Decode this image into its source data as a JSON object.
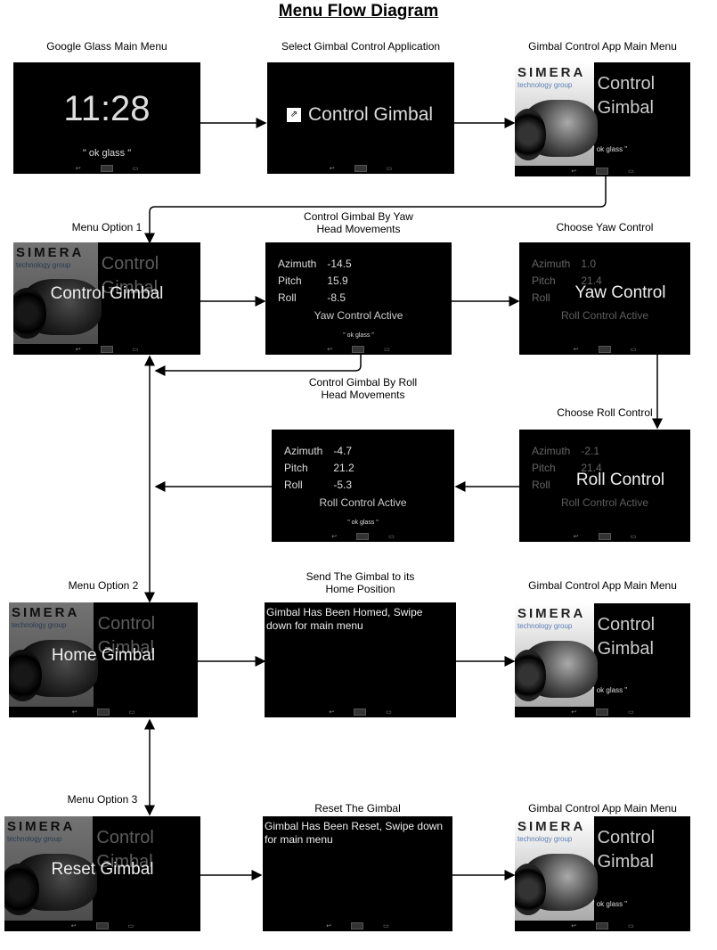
{
  "title": "Menu Flow Diagram",
  "colors": {
    "screen_bg": "#000000",
    "arrow": "#000000",
    "brand_blue": "#5a7fb5"
  },
  "nav_icons": [
    "back-icon",
    "home-icon",
    "recent-apps-icon"
  ],
  "screens": [
    {
      "id": "glass-main",
      "label": "Google Glass Main Menu",
      "type": "clock",
      "time": "11:28",
      "hint": "\" ok glass \""
    },
    {
      "id": "select-app",
      "label": "Select Gimbal Control Application",
      "type": "app",
      "icon": "app-icon",
      "text": "Control Gimbal"
    },
    {
      "id": "app-main-1",
      "label": "Gimbal Control App Main Menu",
      "type": "menu",
      "brand": "SIMERA",
      "brand_sub": "technology group",
      "lines": [
        "Control",
        "Gimbal"
      ],
      "hint": "\" ok glass \""
    },
    {
      "id": "option-1",
      "label": "Menu Option 1",
      "type": "menu",
      "brand": "SIMERA",
      "brand_sub": "technology group",
      "lines": [
        "Control",
        "Gimbal"
      ],
      "overlay": "Control Gimbal"
    },
    {
      "id": "yaw-mode",
      "label": "Control Gimbal By Yaw\nHead Movements",
      "type": "readout",
      "rows": [
        [
          "Azimuth",
          "-14.5"
        ],
        [
          "Pitch",
          "15.9"
        ],
        [
          "Roll",
          "-8.5"
        ]
      ],
      "status": "Yaw Control Active",
      "hint": "\" ok glass \""
    },
    {
      "id": "choose-yaw",
      "label": "Choose Yaw Control",
      "type": "readout",
      "rows": [
        [
          "Azimuth",
          "1.0"
        ],
        [
          "Pitch",
          "21.4"
        ],
        [
          "Roll",
          ""
        ]
      ],
      "status": "Roll Control Active",
      "overlay": "Yaw Control"
    },
    {
      "id": "roll-mode",
      "label": "Control Gimbal By Roll\nHead Movements",
      "type": "readout",
      "rows": [
        [
          "Azimuth",
          "-4.7"
        ],
        [
          "Pitch",
          "21.2"
        ],
        [
          "Roll",
          "-5.3"
        ]
      ],
      "status": "Roll Control Active",
      "hint": "\" ok glass \""
    },
    {
      "id": "choose-roll",
      "label": "Choose Roll Control",
      "type": "readout",
      "rows": [
        [
          "Azimuth",
          "-2.1"
        ],
        [
          "Pitch",
          "21.4"
        ],
        [
          "Roll",
          ""
        ]
      ],
      "status": "Roll Control Active",
      "overlay": "Roll Control"
    },
    {
      "id": "option-2",
      "label": "Menu Option 2",
      "type": "menu",
      "brand": "SIMERA",
      "brand_sub": "technology group",
      "lines": [
        "Control",
        "Gimbal"
      ],
      "overlay": "Home Gimbal"
    },
    {
      "id": "home",
      "label": "Send The Gimbal to its\nHome Position",
      "type": "message",
      "text": "Gimbal Has Been Homed, Swipe down for main menu"
    },
    {
      "id": "app-main-2",
      "label": "Gimbal Control App Main Menu",
      "type": "menu",
      "brand": "SIMERA",
      "brand_sub": "technology group",
      "lines": [
        "Control",
        "Gimbal"
      ],
      "hint": "\" ok glass \""
    },
    {
      "id": "option-3",
      "label": "Menu Option 3",
      "type": "menu",
      "brand": "SIMERA",
      "brand_sub": "technology group",
      "lines": [
        "Control",
        "Gimbal"
      ],
      "overlay": "Reset Gimbal"
    },
    {
      "id": "reset",
      "label": "Reset The Gimbal",
      "type": "message",
      "text": "Gimbal Has Been Reset, Swipe down for main menu"
    },
    {
      "id": "app-main-3",
      "label": "Gimbal Control App Main Menu",
      "type": "menu",
      "brand": "SIMERA",
      "brand_sub": "technology group",
      "lines": [
        "Control",
        "Gimbal"
      ],
      "hint": "\" ok glass \""
    }
  ]
}
